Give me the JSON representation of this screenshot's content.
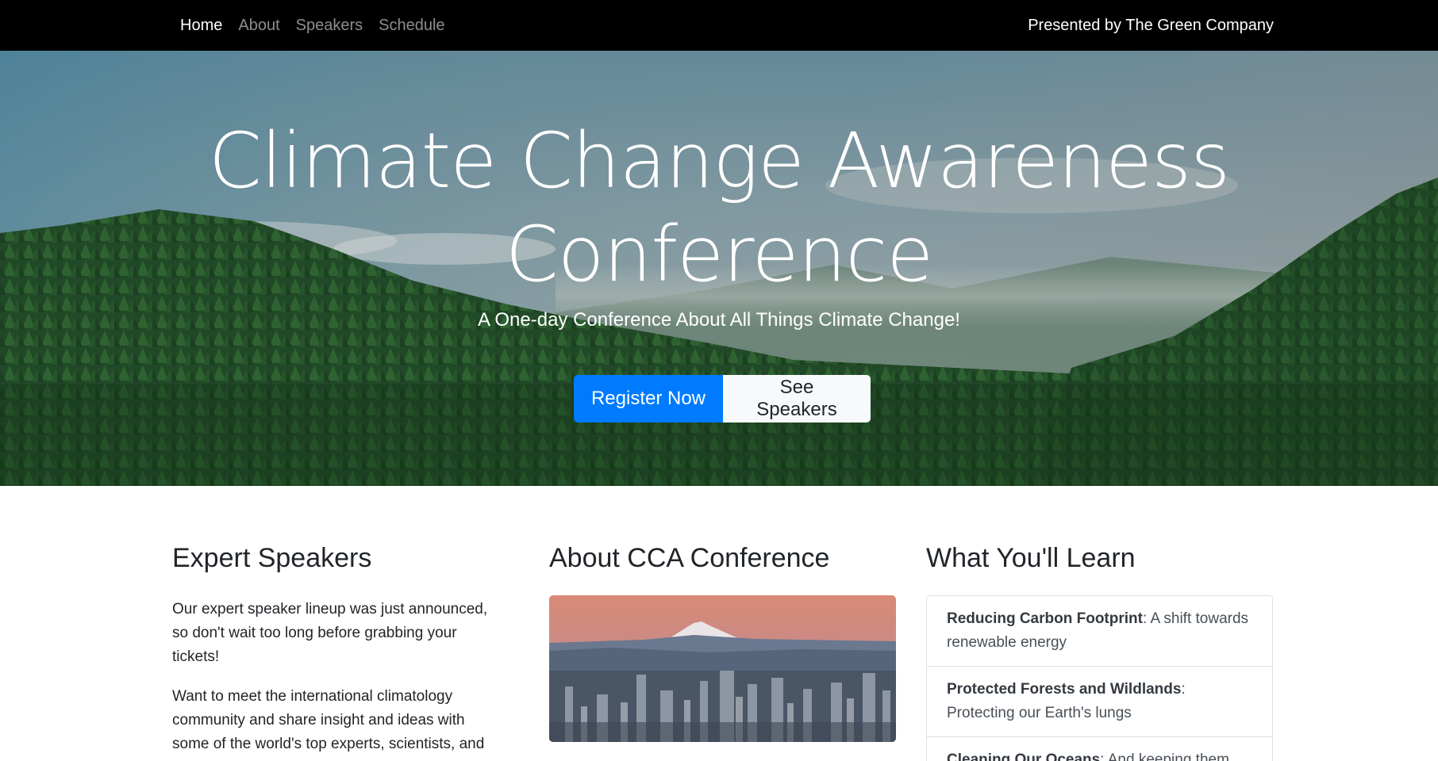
{
  "nav": {
    "links": [
      {
        "label": "Home",
        "active": true
      },
      {
        "label": "About",
        "active": false
      },
      {
        "label": "Speakers",
        "active": false
      },
      {
        "label": "Schedule",
        "active": false
      }
    ],
    "brand": "Presented by The Green Company"
  },
  "hero": {
    "title_line1": "Climate Change Awareness",
    "title_line2": "Conference",
    "subtitle": "A One-day Conference About All Things Climate Change!",
    "register_label": "Register Now",
    "speakers_label": "See Speakers"
  },
  "speakers_section": {
    "heading": "Expert Speakers",
    "para1": "Our expert speaker lineup was just announced, so don't wait too long before grabbing your tickets!",
    "para2": "Want to meet the international climatology community and share insight and ideas with some of the world's top experts, scientists, and"
  },
  "about_section": {
    "heading": "About CCA Conference"
  },
  "learn_section": {
    "heading": "What You'll Learn",
    "items": [
      {
        "title": "Reducing Carbon Footprint",
        "desc": ": A shift towards renewable energy"
      },
      {
        "title": "Protected Forests and Wildlands",
        "desc": ": Protecting our Earth's lungs"
      },
      {
        "title": "Cleaning Our Oceans",
        "desc": ": And keeping them"
      }
    ]
  },
  "colors": {
    "navbar_bg": "#000000",
    "primary": "#007bff",
    "light": "#f8f9fa"
  }
}
